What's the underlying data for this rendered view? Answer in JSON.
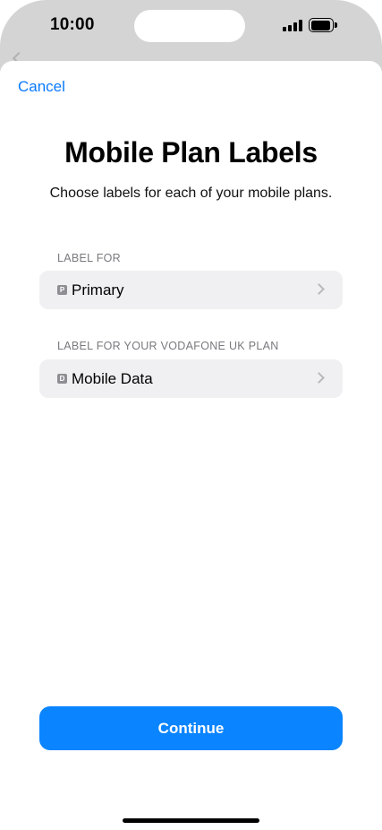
{
  "status_bar": {
    "time": "10:00",
    "icons": [
      "cellular-signal-icon",
      "battery-icon"
    ]
  },
  "navigation": {
    "cancel_label": "Cancel"
  },
  "header": {
    "title": "Mobile Plan Labels",
    "subtitle": "Choose labels for each of your mobile plans."
  },
  "sections": [
    {
      "header": "LABEL FOR",
      "row": {
        "badge": "P",
        "label": "Primary",
        "icon": "chevron-right-icon"
      }
    },
    {
      "header": "LABEL FOR YOUR VODAFONE UK PLAN",
      "row": {
        "badge": "D",
        "label": "Mobile Data",
        "icon": "chevron-right-icon"
      }
    }
  ],
  "footer": {
    "continue_label": "Continue"
  },
  "colors": {
    "accent": "#0a84ff",
    "link": "#0a7aff",
    "row_background": "#f0f0f2",
    "secondary_text": "#7a7a7f"
  }
}
